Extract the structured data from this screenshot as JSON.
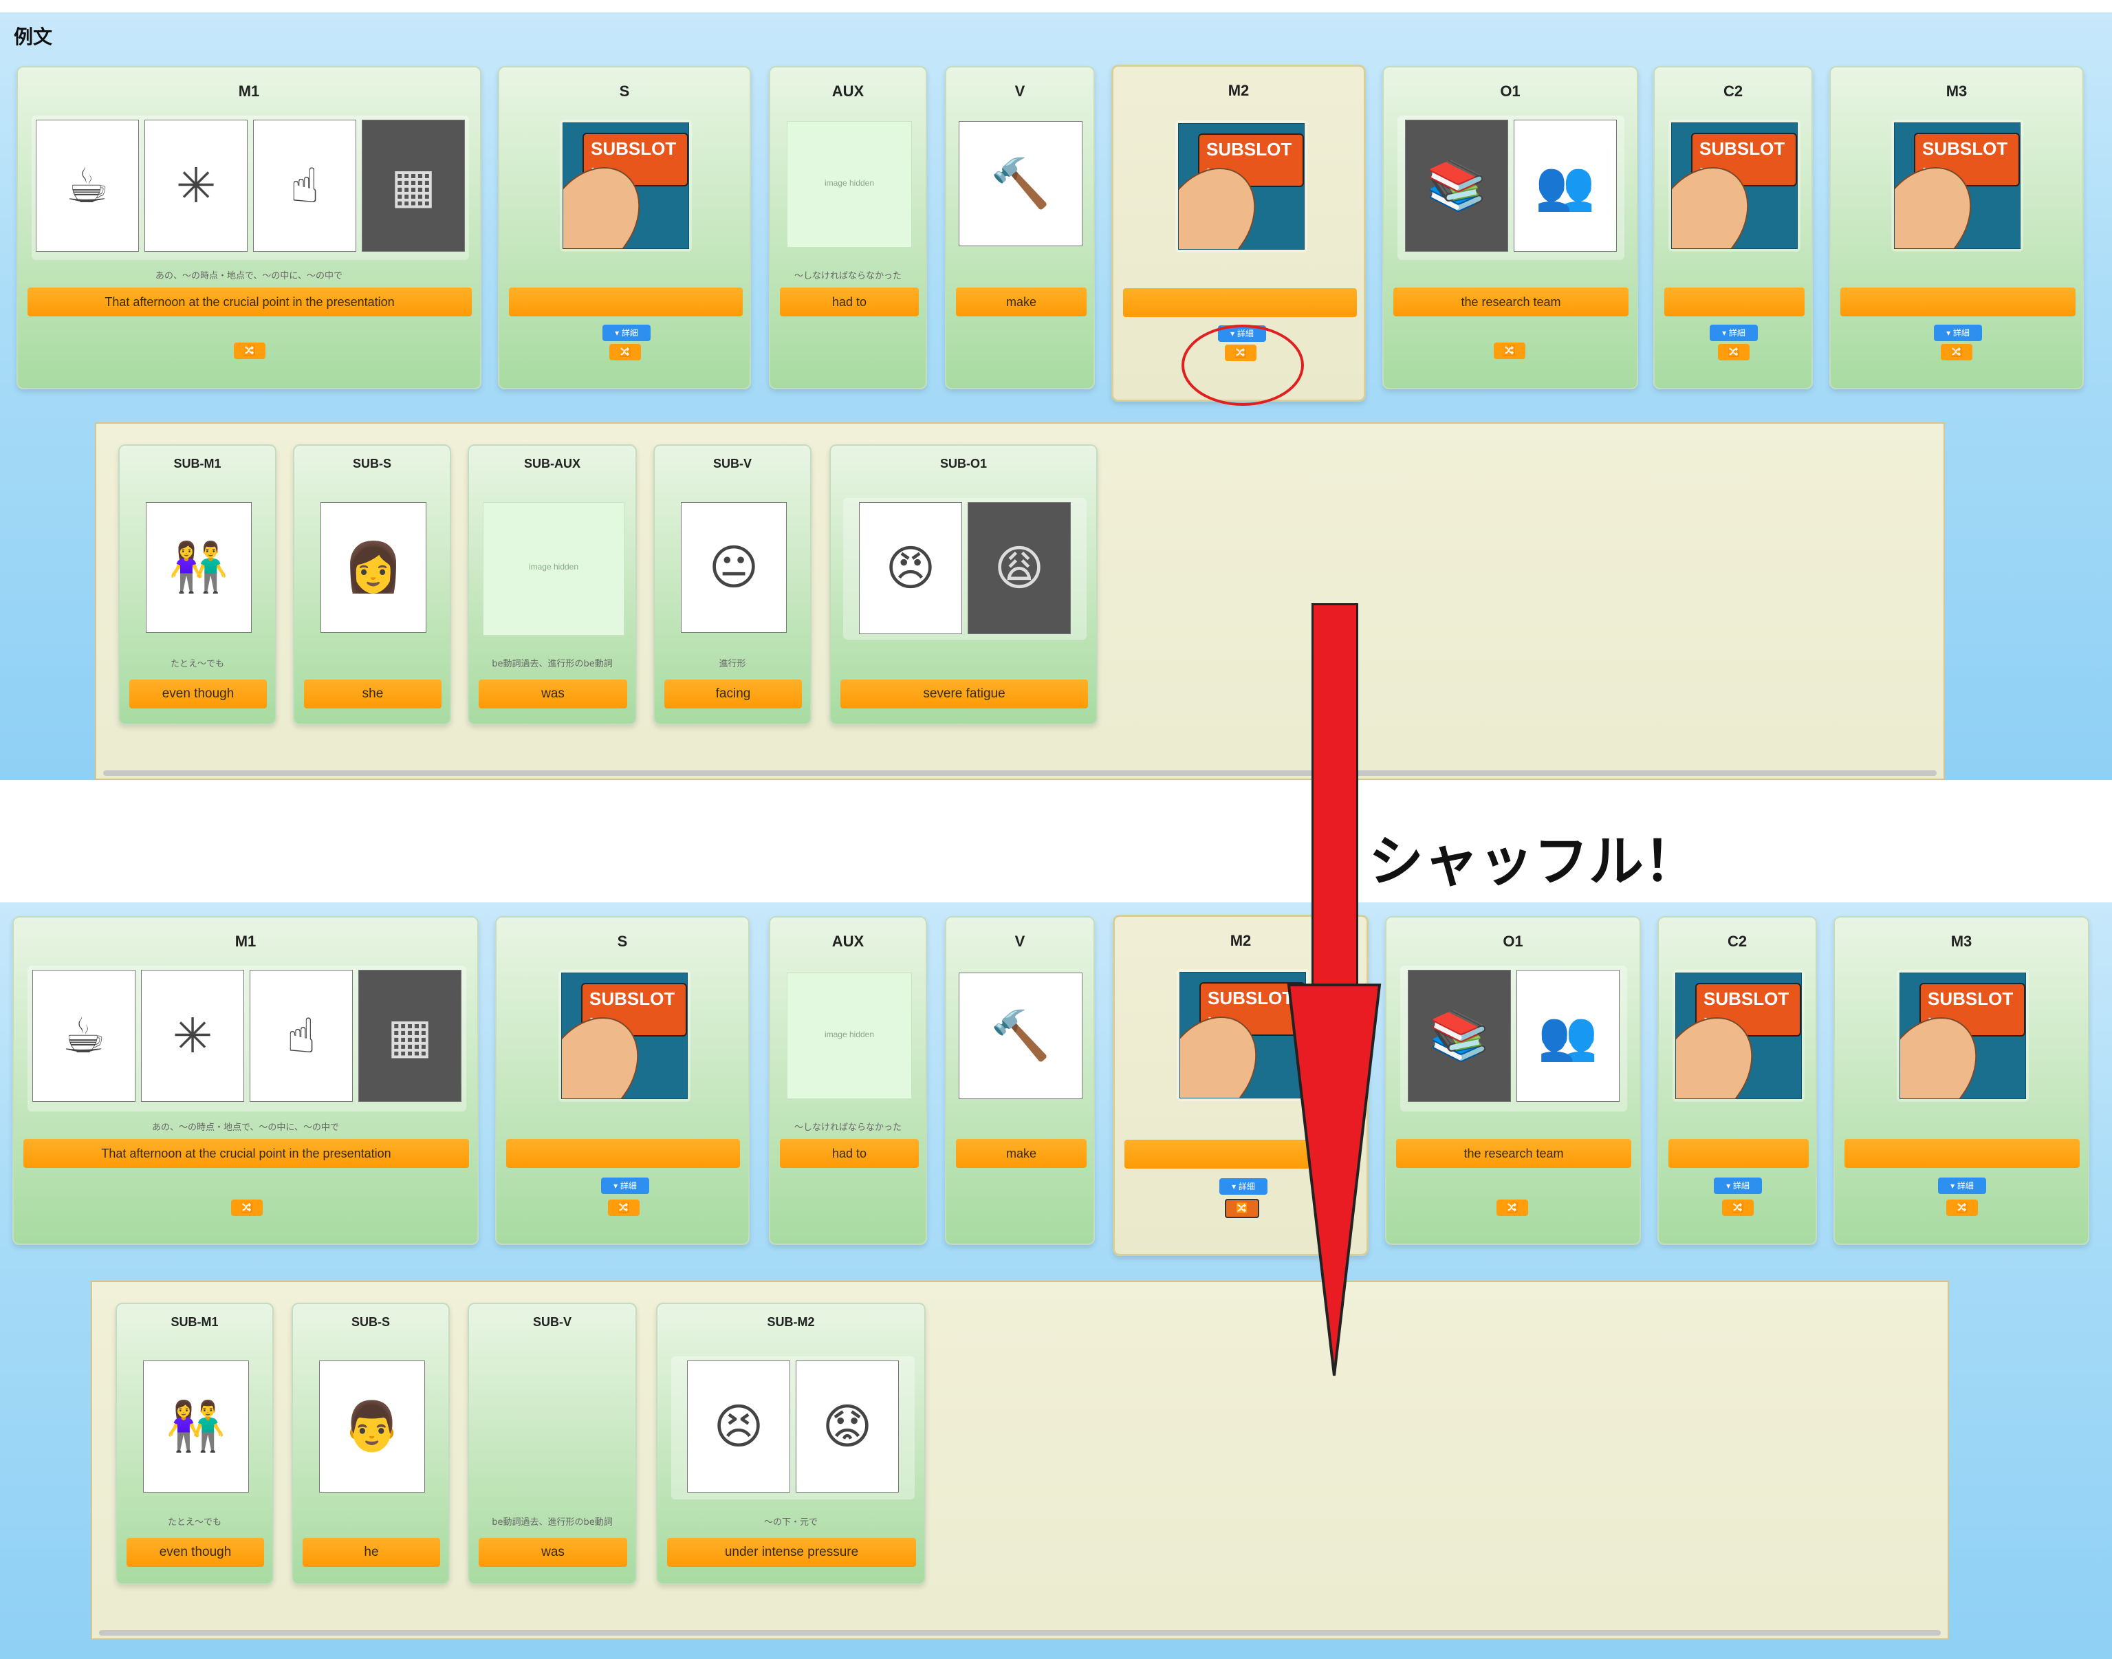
{
  "header": {
    "title": "例文"
  },
  "annotation": {
    "text": "シャッフル！"
  },
  "slot_buttons": {
    "detail_label": "▾ 詳細",
    "shuffle_icon": "🔀"
  },
  "image_placeholder": "image hidden",
  "subslot_tag": "SUBSLOT ›",
  "top": {
    "slots": {
      "m1": {
        "label": "M1",
        "caption": "あの、〜の時点・地点で、〜の中に、〜の中で",
        "phrase": "That afternoon at the crucial point in the presentation"
      },
      "s": {
        "label": "S",
        "phrase": ""
      },
      "aux": {
        "label": "AUX",
        "caption": "〜しなければならなかった",
        "phrase": "had to"
      },
      "v": {
        "label": "V",
        "phrase": "make"
      },
      "m2": {
        "label": "M2",
        "phrase": ""
      },
      "o1": {
        "label": "O1",
        "phrase": "the research team"
      },
      "c2": {
        "label": "C2",
        "phrase": ""
      },
      "m3": {
        "label": "M3",
        "phrase": ""
      }
    },
    "subslots": {
      "m1": {
        "label": "SUB-M1",
        "caption": "たとえ〜でも",
        "phrase": "even though"
      },
      "s": {
        "label": "SUB-S",
        "phrase": "she"
      },
      "aux": {
        "label": "SUB-AUX",
        "caption": "be動詞過去、進行形のbe動詞",
        "phrase": "was"
      },
      "v": {
        "label": "SUB-V",
        "caption": "進行形",
        "phrase": "facing"
      },
      "o1": {
        "label": "SUB-O1",
        "phrase": "severe fatigue"
      }
    }
  },
  "bottom": {
    "slots": {
      "m1": {
        "label": "M1",
        "caption": "あの、〜の時点・地点で、〜の中に、〜の中で",
        "phrase": "That afternoon at the crucial point in the presentation"
      },
      "s": {
        "label": "S",
        "phrase": ""
      },
      "aux": {
        "label": "AUX",
        "caption": "〜しなければならなかった",
        "phrase": "had to"
      },
      "v": {
        "label": "V",
        "phrase": "make"
      },
      "m2": {
        "label": "M2",
        "phrase": ""
      },
      "o1": {
        "label": "O1",
        "phrase": "the research team"
      },
      "c2": {
        "label": "C2",
        "phrase": ""
      },
      "m3": {
        "label": "M3",
        "phrase": ""
      }
    },
    "subslots": {
      "m1": {
        "label": "SUB-M1",
        "caption": "たとえ〜でも",
        "phrase": "even though"
      },
      "s": {
        "label": "SUB-S",
        "phrase": "he"
      },
      "v": {
        "label": "SUB-V",
        "caption": "be動詞過去、進行形のbe動詞",
        "phrase": "was"
      },
      "m2": {
        "label": "SUB-M2",
        "caption": "〜の下・元で",
        "phrase": "under intense pressure"
      }
    }
  }
}
